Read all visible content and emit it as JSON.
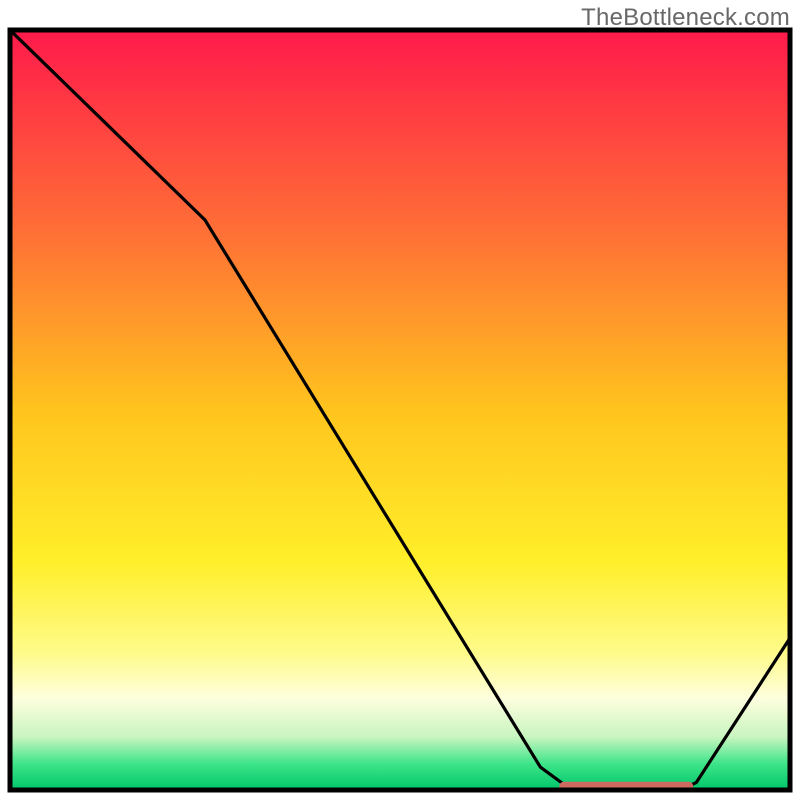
{
  "watermark": "TheBottleneck.com",
  "chart_data": {
    "type": "line",
    "title": "",
    "xlabel": "",
    "ylabel": "",
    "xlim": [
      0,
      100
    ],
    "ylim": [
      0,
      100
    ],
    "x": [
      0,
      25,
      68,
      72,
      86,
      88,
      100
    ],
    "values": [
      100,
      75,
      3,
      0,
      0,
      1,
      20
    ],
    "flat_segment": {
      "x_start": 71,
      "x_end": 87,
      "y": 0.5,
      "color": "#cc6a5f"
    },
    "gradient_stops": [
      {
        "offset": 0.0,
        "color": "#ff1a4b"
      },
      {
        "offset": 0.25,
        "color": "#ff6a37"
      },
      {
        "offset": 0.5,
        "color": "#ffc41e"
      },
      {
        "offset": 0.7,
        "color": "#ffef2a"
      },
      {
        "offset": 0.82,
        "color": "#fffb8a"
      },
      {
        "offset": 0.88,
        "color": "#fdfede"
      },
      {
        "offset": 0.93,
        "color": "#c9f5c0"
      },
      {
        "offset": 0.965,
        "color": "#3fe589"
      },
      {
        "offset": 1.0,
        "color": "#00c66a"
      }
    ],
    "border_color": "#000000"
  }
}
